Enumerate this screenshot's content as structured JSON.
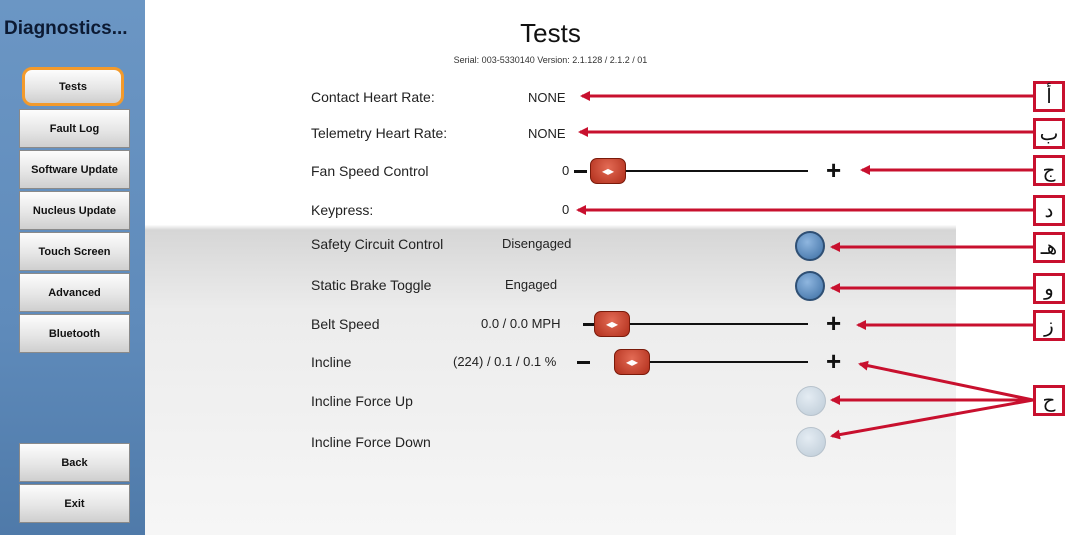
{
  "sidebar": {
    "title": "Diagnostics...",
    "items": [
      {
        "label": "Tests"
      },
      {
        "label": "Fault Log"
      },
      {
        "label": "Software Update"
      },
      {
        "label": "Nucleus Update"
      },
      {
        "label": "Touch Screen"
      },
      {
        "label": "Advanced"
      },
      {
        "label": "Bluetooth"
      }
    ],
    "back_label": "Back",
    "exit_label": "Exit"
  },
  "header": {
    "title": "Tests",
    "serial": "Serial: 003-5330140   Version: 2.1.128 / 2.1.2 / 01"
  },
  "tests": {
    "contact_hr": {
      "label": "Contact Heart Rate:",
      "value": "NONE"
    },
    "telemetry_hr": {
      "label": "Telemetry Heart Rate:",
      "value": "NONE"
    },
    "fan_speed": {
      "label": "Fan Speed Control",
      "value": "0"
    },
    "keypress": {
      "label": "Keypress:",
      "value": "0"
    },
    "safety_circuit": {
      "label": "Safety Circuit Control",
      "value": "Disengaged"
    },
    "static_brake": {
      "label": "Static Brake Toggle",
      "value": "Engaged"
    },
    "belt_speed": {
      "label": "Belt Speed",
      "value": "0.0 / 0.0 MPH"
    },
    "incline": {
      "label": "Incline",
      "value": "(224) / 0.1 / 0.1 %"
    },
    "incline_up": {
      "label": "Incline Force Up"
    },
    "incline_down": {
      "label": "Incline Force Down"
    }
  },
  "callouts": [
    "أ",
    "ب",
    "ج",
    "د",
    "هـ",
    "و",
    "ز",
    "ح"
  ],
  "colors": {
    "accent_active": "#f39a2b",
    "callout_red": "#c8102e",
    "sidebar_blue": "#5f8bbb"
  }
}
